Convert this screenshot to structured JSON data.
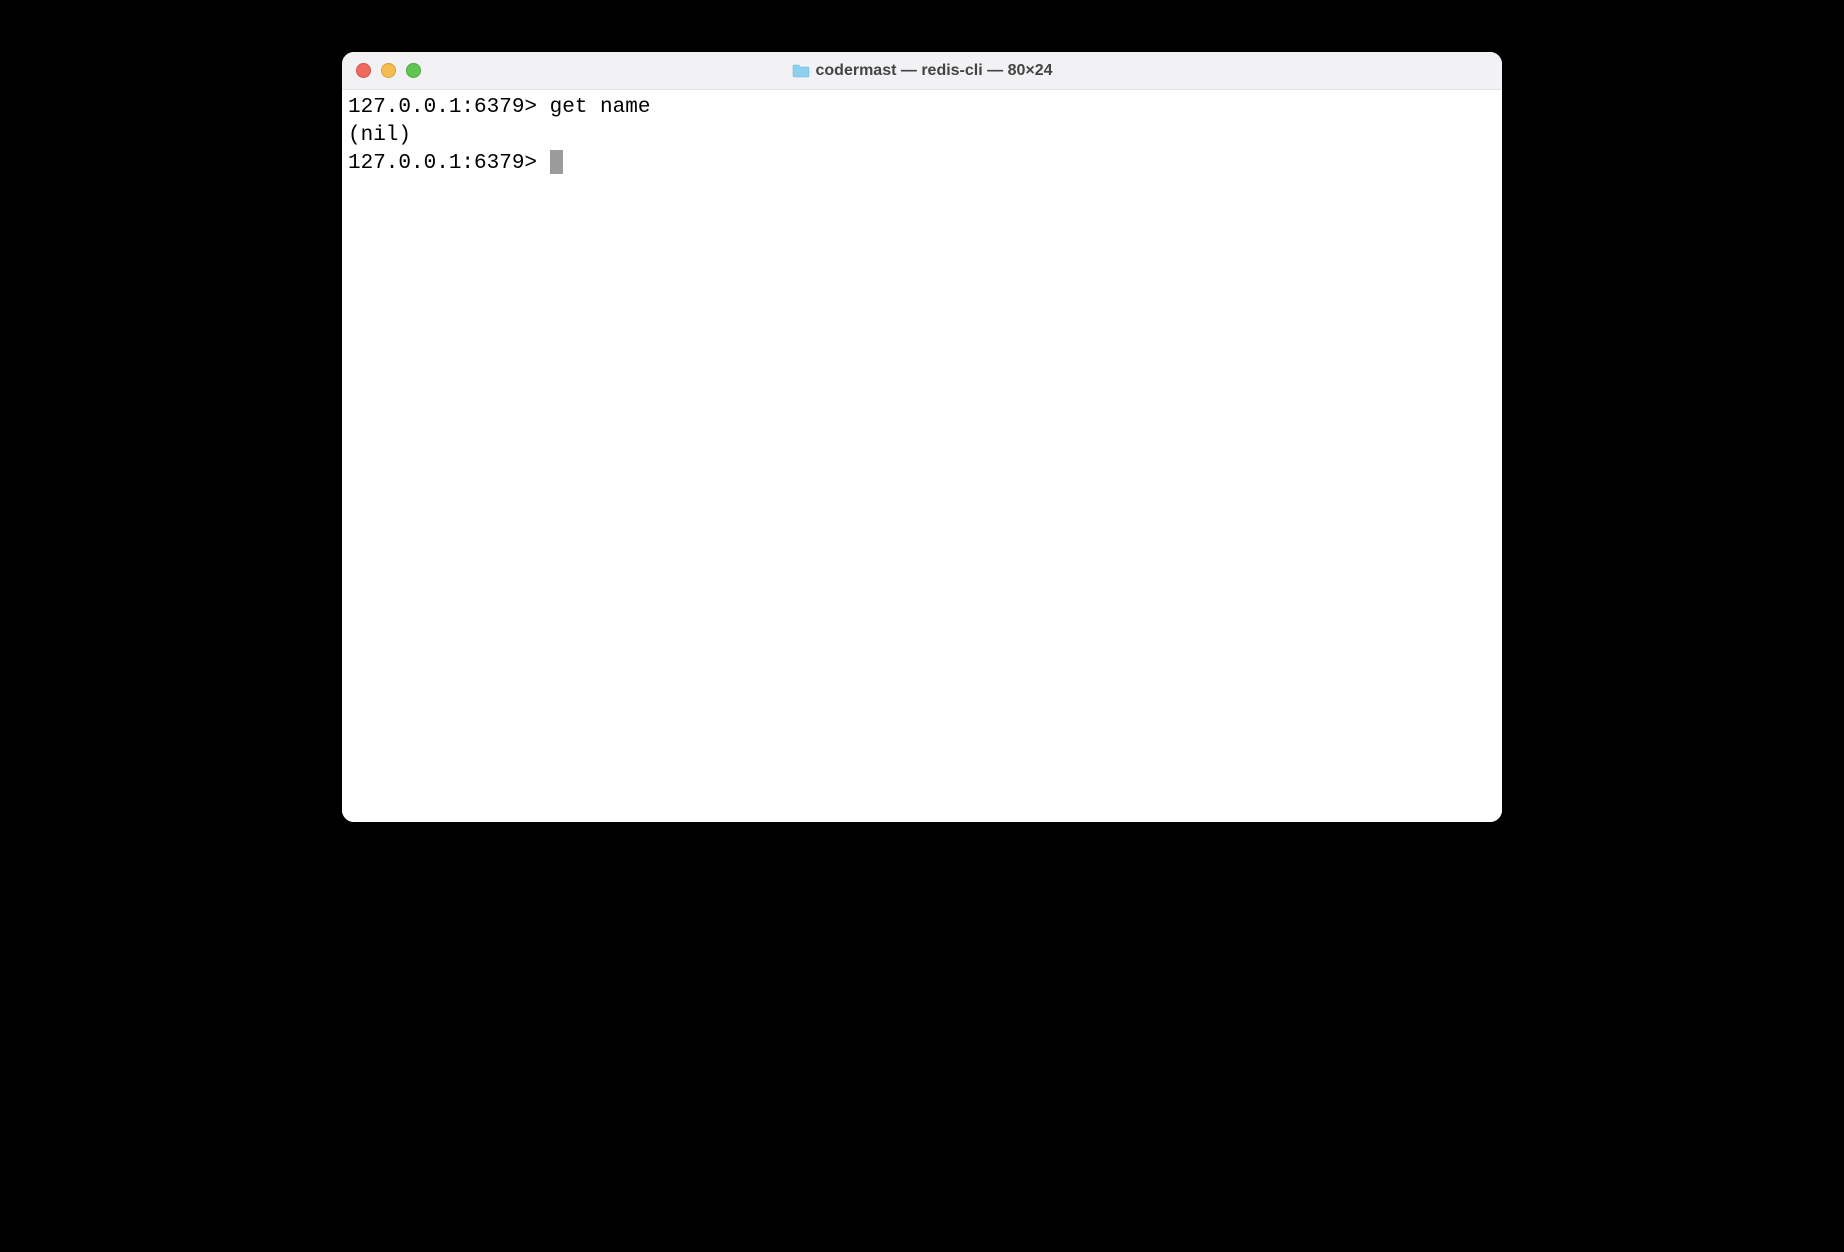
{
  "window": {
    "title": "codermast — redis-cli — 80×24"
  },
  "terminal": {
    "lines": [
      {
        "prompt": "127.0.0.1:6379>",
        "command": " get name"
      },
      {
        "output": "(nil)"
      },
      {
        "prompt": "127.0.0.1:6379> ",
        "cursor": true
      }
    ]
  }
}
